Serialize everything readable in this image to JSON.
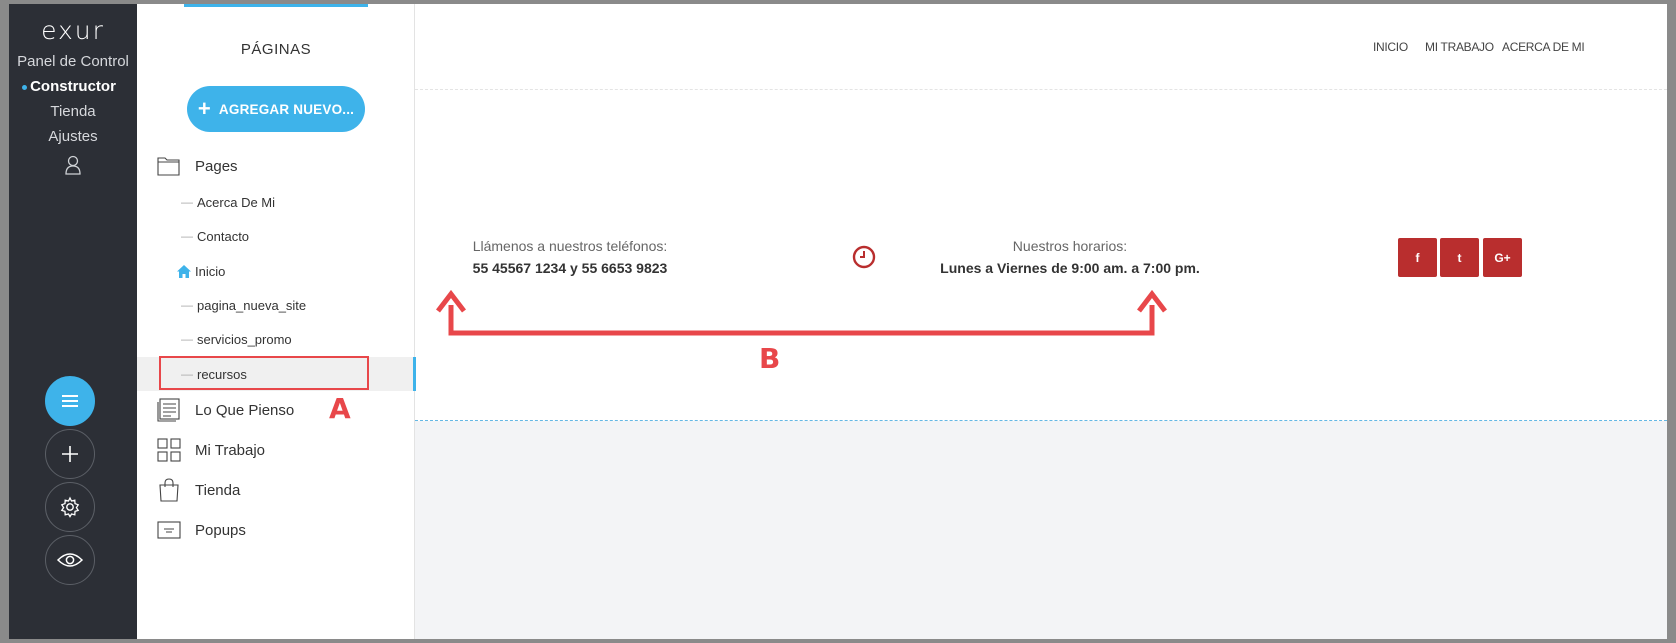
{
  "nav": {
    "logo": "exur",
    "items": [
      {
        "label": "Panel de Control",
        "active": false
      },
      {
        "label": "Constructor",
        "active": true
      },
      {
        "label": "Tienda",
        "active": false
      },
      {
        "label": "Ajustes",
        "active": false
      }
    ],
    "accent": "#3eb3ea"
  },
  "panel": {
    "title": "PÁGINAS",
    "add_button": "AGREGAR NUEVO...",
    "pages_folder": "Pages",
    "pages": [
      {
        "label": "Acerca De Mi"
      },
      {
        "label": "Contacto"
      },
      {
        "label": "Inicio",
        "home": true
      },
      {
        "label": "pagina_nueva_site"
      },
      {
        "label": "servicios_promo"
      },
      {
        "label": "recursos",
        "selected": true
      }
    ],
    "groups": [
      {
        "label": "Lo Que Pienso",
        "icon": "blog-icon"
      },
      {
        "label": "Mi Trabajo",
        "icon": "grid-icon"
      },
      {
        "label": "Tienda",
        "icon": "bag-icon"
      },
      {
        "label": "Popups",
        "icon": "popup-icon"
      }
    ]
  },
  "annotations": {
    "a": "A",
    "b": "B",
    "color": "#e8474a"
  },
  "site": {
    "menu": [
      "INICIO",
      "MI TRABAJO",
      "ACERCA DE MI"
    ],
    "phone_label": "Llámenos a nuestros teléfonos:",
    "phone_value": "55 45567 1234 y 55 6653 9823",
    "hours_label": "Nuestros horarios:",
    "hours_value": "Lunes a Viernes de 9:00 am. a 7:00 pm.",
    "social": [
      "f",
      "t",
      "G+"
    ],
    "social_color": "#b92e2e"
  }
}
